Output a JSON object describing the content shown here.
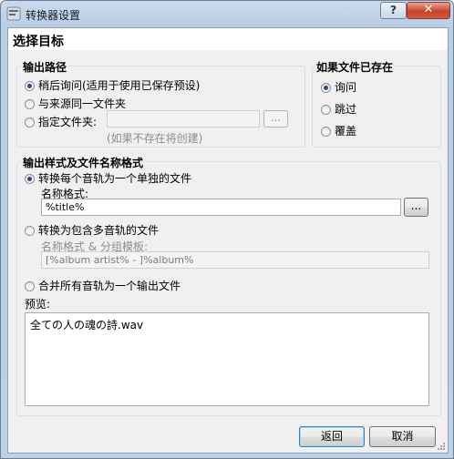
{
  "window": {
    "title": "转换器设置",
    "help_label": "?",
    "close_label": "✕"
  },
  "section_title": "选择目标",
  "output_path": {
    "group_label": "输出路径",
    "options": [
      {
        "label": "稍后询问(适用于使用已保存预设)",
        "selected": true
      },
      {
        "label": "与来源同一文件夹",
        "selected": false
      },
      {
        "label": "指定文件夹:",
        "selected": false
      }
    ],
    "folder_value": "",
    "browse_label": "...",
    "hint": "(如果不存在将创建)"
  },
  "if_exists": {
    "group_label": "如果文件已存在",
    "options": [
      {
        "label": "询问",
        "selected": true
      },
      {
        "label": "跳过",
        "selected": false
      },
      {
        "label": "覆盖",
        "selected": false
      }
    ]
  },
  "output_style": {
    "group_label": "输出样式及文件名称格式",
    "single": {
      "label": "转换每个音轨为一个单独的文件",
      "selected": true
    },
    "name_format_label": "名称格式:",
    "name_format_value": "%title%",
    "browse_label": "...",
    "multi": {
      "label": "转换为包含多音轨的文件",
      "selected": false
    },
    "multi_format_label": "名称格式 & 分组模板:",
    "multi_format_value": "[%album artist% - ]%album%",
    "merge": {
      "label": "合并所有音轨为一个输出文件",
      "selected": false
    },
    "preview_label": "预览:",
    "preview_text": "全ての人の魂の詩.wav"
  },
  "footer": {
    "back_label": "返回",
    "cancel_label": "取消"
  }
}
